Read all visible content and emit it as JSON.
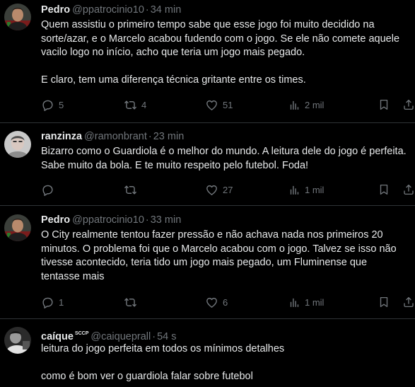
{
  "replies": [
    {
      "name": "Pedro",
      "badge": "",
      "handle": "@ppatrocinio10",
      "time": "34 min",
      "paragraphs": [
        "Quem assistiu o primeiro tempo sabe que esse jogo foi muito decidido na sorte/azar, e o Marcelo acabou fudendo com o jogo. Se ele não comete aquele vacilo logo no início, acho que teria um jogo mais pegado.",
        "E claro, tem uma diferença técnica gritante entre os times."
      ],
      "replies_count": "5",
      "retweets": "4",
      "likes": "51",
      "views": "2 mil"
    },
    {
      "name": "ranzinza",
      "badge": "",
      "handle": "@ramonbrant",
      "time": "23 min",
      "paragraphs": [
        "Bizarro como o Guardiola é o melhor do mundo. A leitura dele do jogo é perfeita. Sabe muito da bola. E te muito respeito pelo futebol. Foda!"
      ],
      "replies_count": "",
      "retweets": "",
      "likes": "27",
      "views": "1 mil"
    },
    {
      "name": "Pedro",
      "badge": "",
      "handle": "@ppatrocinio10",
      "time": "33 min",
      "paragraphs": [
        "O City realmente tentou fazer pressão e não achava nada nos primeiros 20 minutos. O problema foi que o Marcelo acabou com o jogo. Talvez se isso não tivesse acontecido, teria tido um jogo mais pegado, um Fluminense que tentasse mais"
      ],
      "replies_count": "1",
      "retweets": "",
      "likes": "6",
      "views": "1 mil"
    },
    {
      "name": "caíque",
      "badge": "SCCP",
      "handle": "@caiqueprall",
      "time": "54 s",
      "paragraphs": [
        "leitura do jogo perfeita em todos os mínimos detalhes",
        "como é bom ver o guardiola falar sobre futebol"
      ],
      "replies_count": "",
      "retweets": "",
      "likes": "",
      "views": ""
    }
  ],
  "separator": "·",
  "icons": {
    "reply": "reply-icon",
    "retweet": "retweet-icon",
    "like": "heart-icon",
    "views": "views-chart-icon",
    "bookmark": "bookmark-icon",
    "share": "share-icon"
  },
  "colors": {
    "background": "#000000",
    "text": "#e7e9ea",
    "muted": "#71767b",
    "divider": "#2f3336"
  }
}
